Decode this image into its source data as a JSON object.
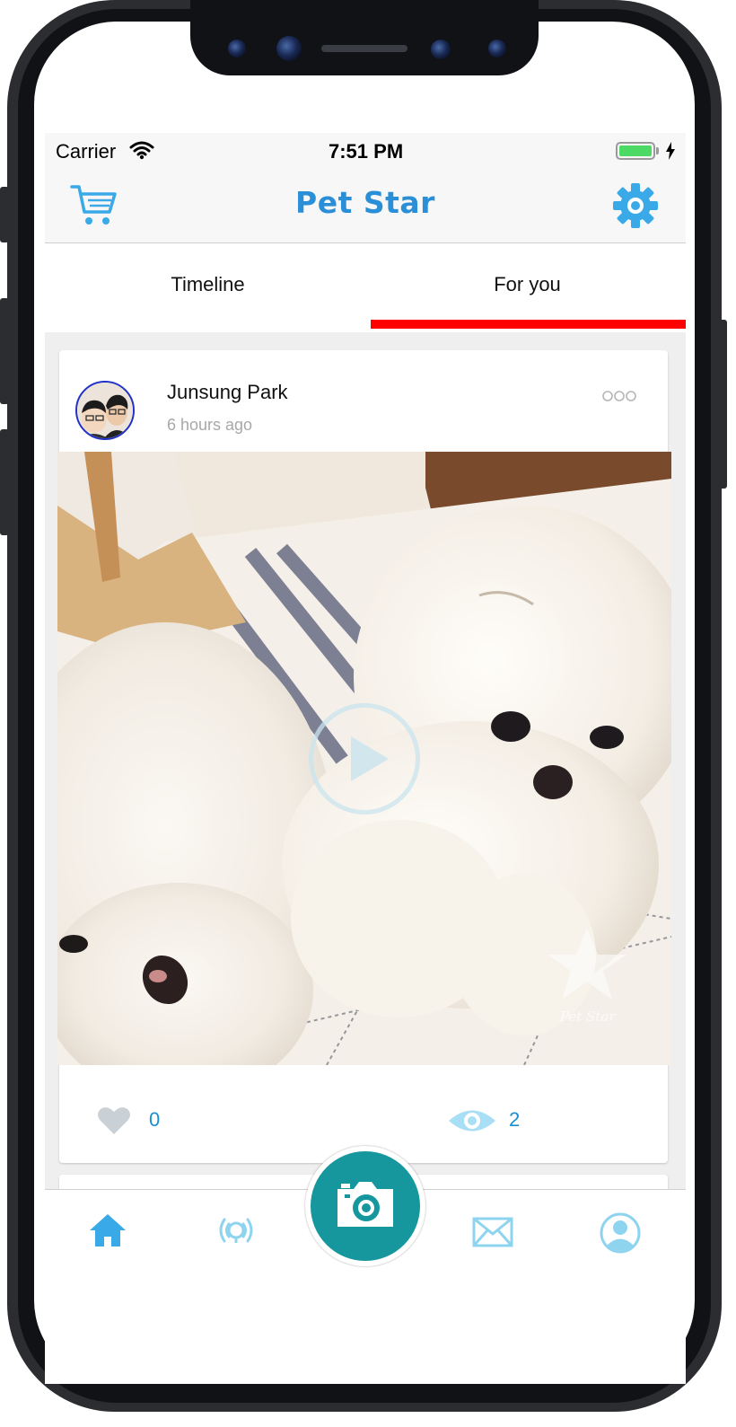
{
  "status_bar": {
    "carrier": "Carrier",
    "time": "7:51 PM"
  },
  "header": {
    "title": "Pet Star",
    "left_icon": "cart-icon",
    "right_icon": "gear-icon"
  },
  "tabs": [
    {
      "label": "Timeline",
      "active": false
    },
    {
      "label": "For you",
      "active": true
    }
  ],
  "post": {
    "author": "Junsung Park",
    "time_ago": "6 hours ago",
    "media_type": "video",
    "watermark": "Pet Star",
    "likes": "0",
    "views": "2"
  },
  "bottom_nav": [
    {
      "icon": "home-icon",
      "active": true
    },
    {
      "icon": "broadcast-icon",
      "active": false
    },
    {
      "icon": "camera-icon",
      "active": false
    },
    {
      "icon": "mail-icon",
      "active": false
    },
    {
      "icon": "profile-icon",
      "active": false
    }
  ],
  "colors": {
    "accent": "#2a8fd6",
    "tab_indicator": "#ff0000",
    "camera_button": "#16979e",
    "count_text": "#1a8fcf"
  }
}
